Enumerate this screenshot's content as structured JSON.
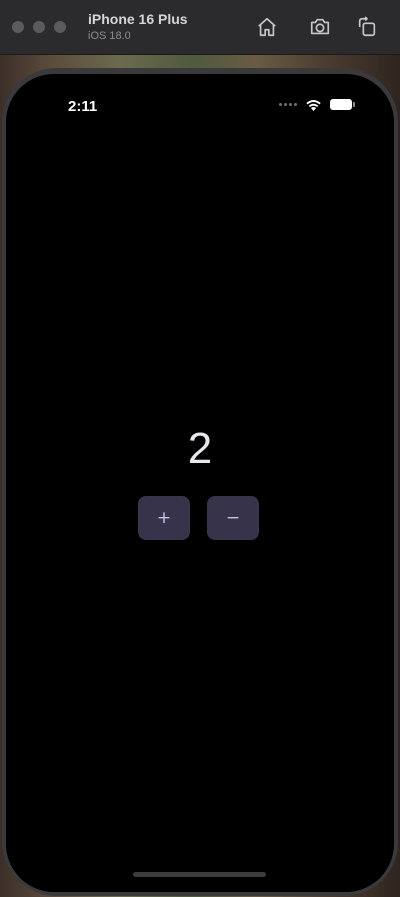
{
  "window": {
    "device_name": "iPhone 16 Plus",
    "device_os": "iOS 18.0",
    "toolbar_icons": [
      "home-icon",
      "screenshot-icon",
      "rotate-icon"
    ]
  },
  "status_bar": {
    "time": "2:11",
    "icons": [
      "cellular-dots-icon",
      "wifi-icon",
      "battery-icon"
    ]
  },
  "app": {
    "counter_value": "2",
    "increment_label": "+",
    "decrement_label": "−"
  },
  "colors": {
    "screen_background": "#000000",
    "button_background": "#37334a",
    "button_text": "#c9bff0",
    "counter_text": "#e8e8ea"
  }
}
